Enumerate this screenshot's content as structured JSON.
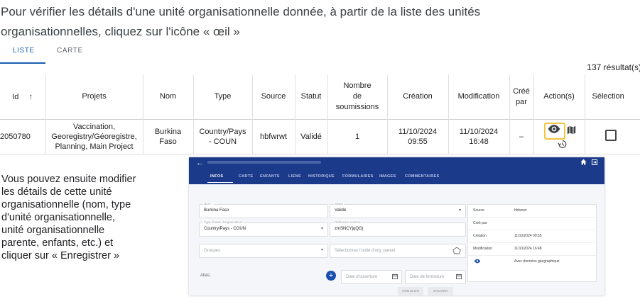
{
  "intro": {
    "line1": "Pour vérifier les détails d'une unité organisationnelle donnée, à partir de la liste des unités",
    "line2": "organisationnelles, cliquez sur l'icône « œil »"
  },
  "tabs": {
    "list": "LISTE",
    "map": "CARTE"
  },
  "result_count": "137 résultat(s)",
  "table": {
    "headers": {
      "id": "Id",
      "projects": "Projets",
      "name": "Nom",
      "type": "Type",
      "source": "Source",
      "status": "Statut",
      "submissions_l1": "Nombre",
      "submissions_l2": "de",
      "submissions_l3": "soumissions",
      "created": "Création",
      "modified": "Modification",
      "created_by_l1": "Créé",
      "created_by_l2": "par",
      "actions": "Action(s)",
      "selection": "Sélection"
    },
    "row": {
      "id": "2050780",
      "projects_l1": "Vaccination,",
      "projects_l2": "Georegistry/Géoregistre,",
      "projects_l3": "Planning, Main Project",
      "name_l1": "Burkina",
      "name_l2": "Faso",
      "type_l1": "Country/Pays",
      "type_l2": "- COUN",
      "source": "hbfwrwt",
      "status": "Validé",
      "submissions": "1",
      "created_date": "11/10/2024",
      "created_time": "09:55",
      "modified_date": "11/10/2024",
      "modified_time": "16:48",
      "created_by": "–"
    }
  },
  "side_text": {
    "l1": "Vous pouvez ensuite modifier",
    "l2": "les détails de cette unité",
    "l3": "organisationnelle (nom, type",
    "l4": "d'unité organisationnelle,",
    "l5": "unité organisationnelle",
    "l6": "parente, enfants, etc.) et",
    "l7": "cliquer sur « Enregistrer »"
  },
  "detail": {
    "tabs": {
      "infos": "INFOS",
      "carte": "CARTE",
      "enfants": "ENFANTS",
      "liens": "LIENS",
      "historique": "HISTORIQUE",
      "formulaires": "FORMULAIRES",
      "images": "IMAGES",
      "commentaires": "COMMENTAIRES"
    },
    "form": {
      "name_label": "Nom *",
      "name_value": "Burkina Faso",
      "status_label": "Statut",
      "status_value": "Validé",
      "type_label": "Type d'unité d'organisation*",
      "type_value": "Country/Pays - COUN",
      "extref_label": "Référence externe",
      "extref_value": "zmSNCYjqQGj",
      "groups_placeholder": "Groupes",
      "parent_placeholder": "Sélectionner l'unité d'org. parent",
      "alias_label": "Alias:",
      "opening_placeholder": "Date d'ouverture",
      "closing_placeholder": "Date de fermeture",
      "cancel": "ANNULER",
      "save": "SAUVER"
    },
    "info": {
      "source_k": "Source",
      "source_v": "hbfwrwt",
      "createdby_k": "Créé par",
      "created_k": "Création",
      "created_v": "11/10/2024 09:55",
      "modified_k": "Modification",
      "modified_v": "11/10/2024 16:48",
      "geo_v": "Avec données géographique"
    }
  },
  "colors": {
    "primary": "#1a5fb0",
    "appbar": "#1b3a8a",
    "highlight": "#f4c542"
  }
}
